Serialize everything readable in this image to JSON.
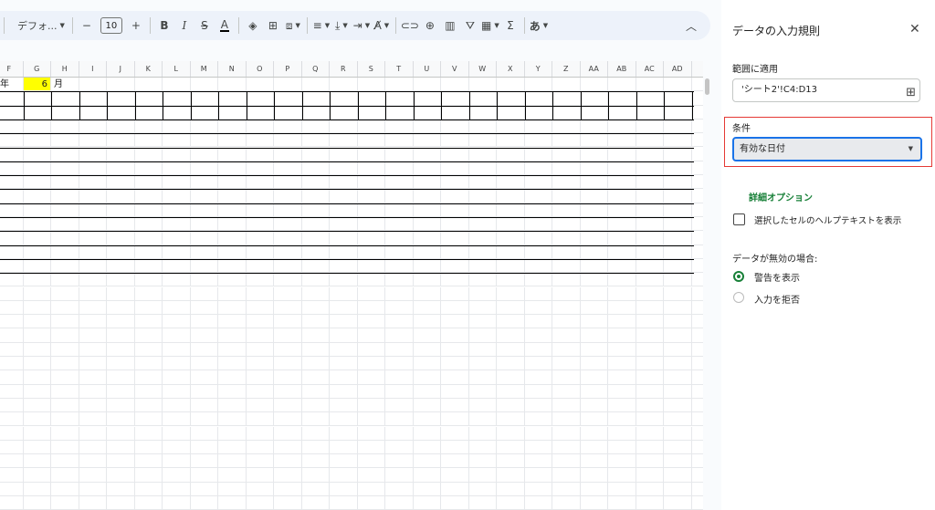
{
  "toolbar": {
    "font_name": "デフォ...",
    "font_size": "10",
    "minus": "−",
    "plus": "+",
    "bold": "B",
    "italic": "I",
    "strike": "S",
    "text_color": "A",
    "input_tools": "あ"
  },
  "sheet": {
    "columns": [
      "F",
      "G",
      "H",
      "I",
      "J",
      "K",
      "L",
      "M",
      "N",
      "O",
      "P",
      "Q",
      "R",
      "S",
      "T",
      "U",
      "V",
      "W",
      "X",
      "Y",
      "Z",
      "AA",
      "AB",
      "AC",
      "AD"
    ],
    "cells": {
      "F1": "年",
      "G1": "6",
      "H1": "月"
    },
    "highlight_color": "#ffff00"
  },
  "panel": {
    "title": "データの入力規則",
    "range_label": "範囲に適用",
    "range_value": "'シート2'!C4:D13",
    "condition_label": "条件",
    "condition_value": "有効な日付",
    "advanced_options": "詳細オプション",
    "help_text_label": "選択したセルのヘルプテキストを表示",
    "invalid_label": "データが無効の場合:",
    "option_warn": "警告を表示",
    "option_reject": "入力を拒否"
  },
  "colors": {
    "accent_green": "#188038",
    "focus_blue": "#1a73e8",
    "highlight_red": "#e53935"
  }
}
